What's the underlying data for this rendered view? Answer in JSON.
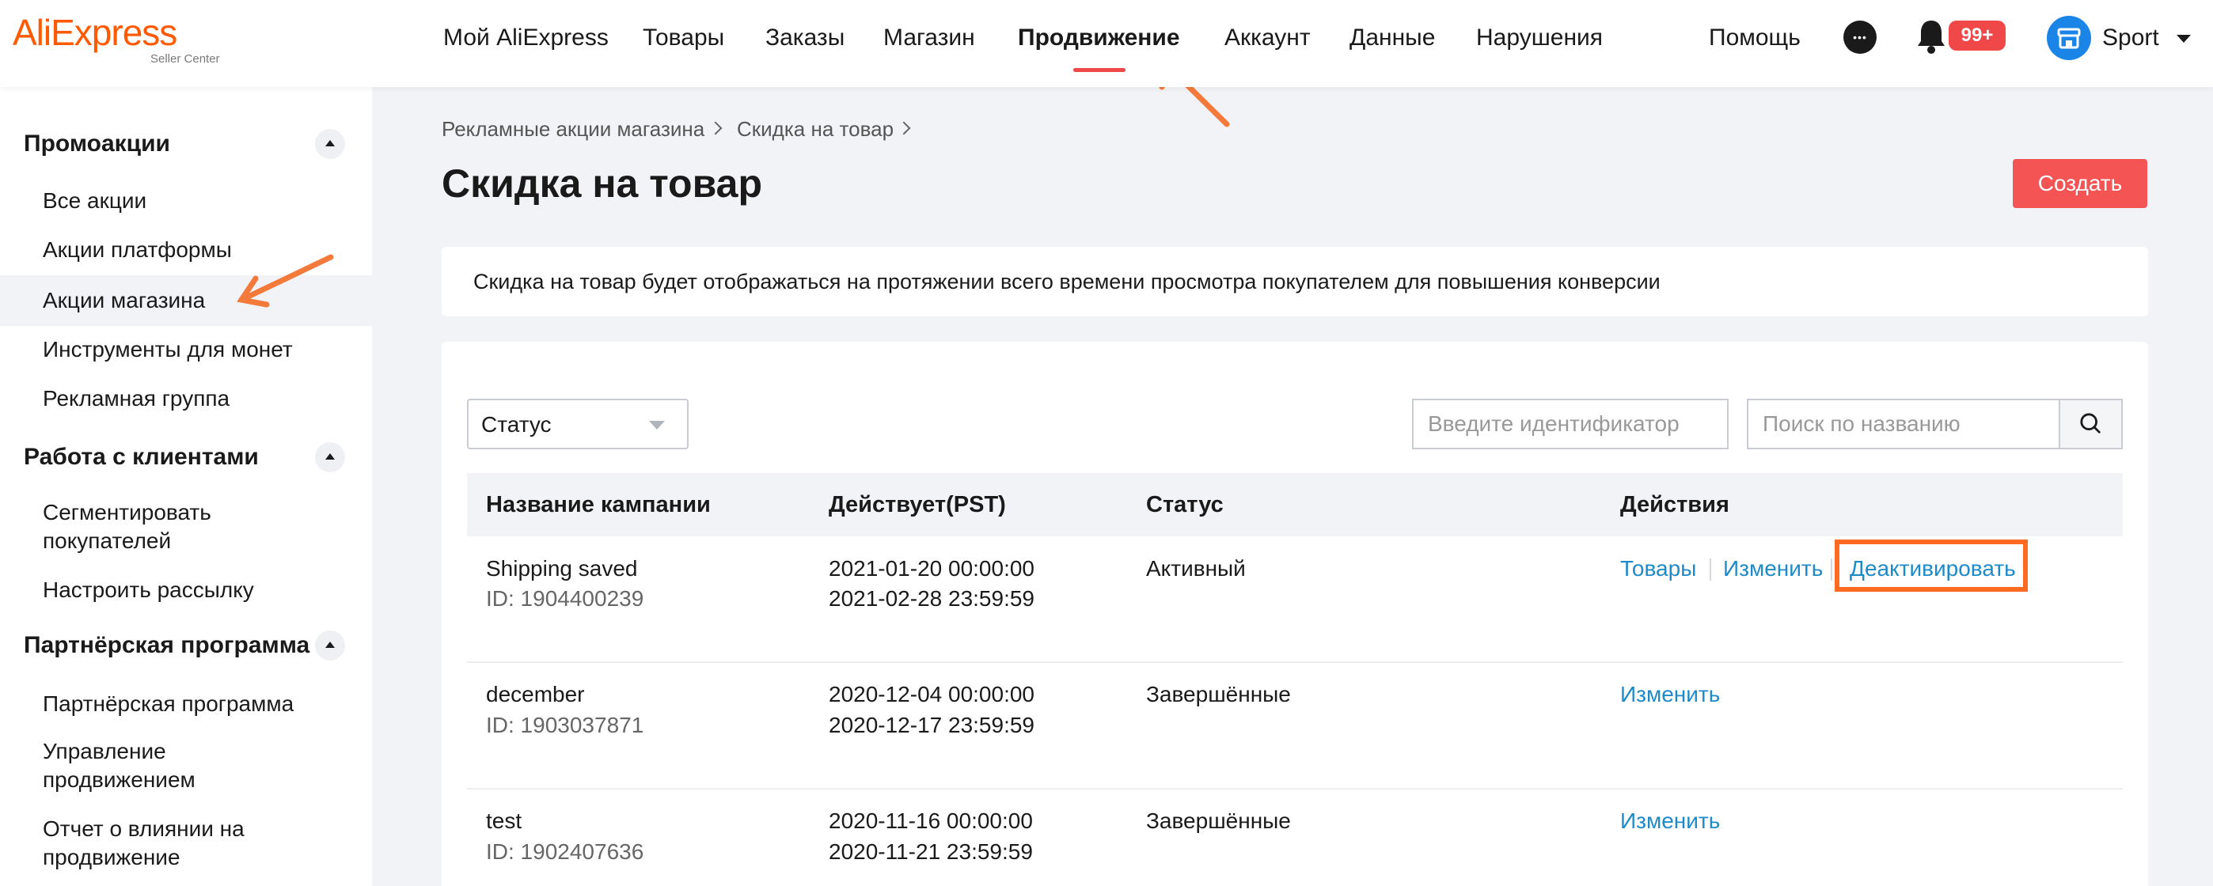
{
  "brand": {
    "logo_text": "AliExpress",
    "logo_subtext": "Seller Center",
    "accent_color": "#ff5a00"
  },
  "topnav": {
    "items": [
      {
        "label": "Мой AliExpress"
      },
      {
        "label": "Товары"
      },
      {
        "label": "Заказы"
      },
      {
        "label": "Магазин"
      },
      {
        "label": "Продвижение",
        "active": true
      },
      {
        "label": "Аккаунт"
      },
      {
        "label": "Данные"
      },
      {
        "label": "Нарушения"
      }
    ],
    "help_label": "Помощь",
    "chat_icon": "chat-bubble-icon",
    "notifications_icon": "bell-icon",
    "notifications_badge": "99+",
    "store_icon": "store-icon",
    "store_name": "Sport",
    "store_menu_icon": "chevron-down-icon"
  },
  "sidebar": {
    "groups": [
      {
        "title": "Промоакции",
        "items": [
          {
            "label": "Все акции"
          },
          {
            "label": "Акции платформы"
          },
          {
            "label": "Акции магазина",
            "active": true
          },
          {
            "label": "Инструменты для монет"
          },
          {
            "label": "Рекламная группа"
          }
        ]
      },
      {
        "title": "Работа с клиентами",
        "items": [
          {
            "label": "Сегментировать покупателей"
          },
          {
            "label": "Настроить рассылку"
          }
        ]
      },
      {
        "title": "Партнёрская программа",
        "items": [
          {
            "label": "Партнёрская программа"
          },
          {
            "label": "Управление продвижением"
          },
          {
            "label": "Отчет о влиянии на продвижение"
          }
        ]
      }
    ]
  },
  "breadcrumb": [
    "Рекламные акции магазина",
    "Скидка на товар"
  ],
  "page": {
    "title": "Скидка на товар",
    "create_label": "Создать",
    "notice": "Скидка на товар будет отображаться на протяжении всего времени просмотра покупателем для повышения конверсии"
  },
  "filters": {
    "status_value": "Статус",
    "id_placeholder": "Введите идентификатор",
    "name_placeholder": "Поиск по названию",
    "search_icon": "search-icon"
  },
  "table": {
    "columns": [
      "Название кампании",
      "Действует(PST)",
      "Статус",
      "Действия"
    ],
    "rows": [
      {
        "name": "Shipping saved",
        "id": "ID: 1904400239",
        "start": "2021-01-20 00:00:00",
        "end": "2021-02-28 23:59:59",
        "status": "Активный",
        "actions": [
          "Товары",
          "Изменить",
          "Деактивировать"
        ]
      },
      {
        "name": "december",
        "id": "ID: 1903037871",
        "start": "2020-12-04 00:00:00",
        "end": "2020-12-17 23:59:59",
        "status": "Завершённые",
        "actions": [
          "Изменить"
        ]
      },
      {
        "name": "test",
        "id": "ID: 1902407636",
        "start": "2020-11-16 00:00:00",
        "end": "2020-11-21 23:59:59",
        "status": "Завершённые",
        "actions": [
          "Изменить"
        ]
      }
    ]
  },
  "annotations": {
    "arrow_color": "#f47a3c",
    "highlight_color": "#ff6a23"
  }
}
